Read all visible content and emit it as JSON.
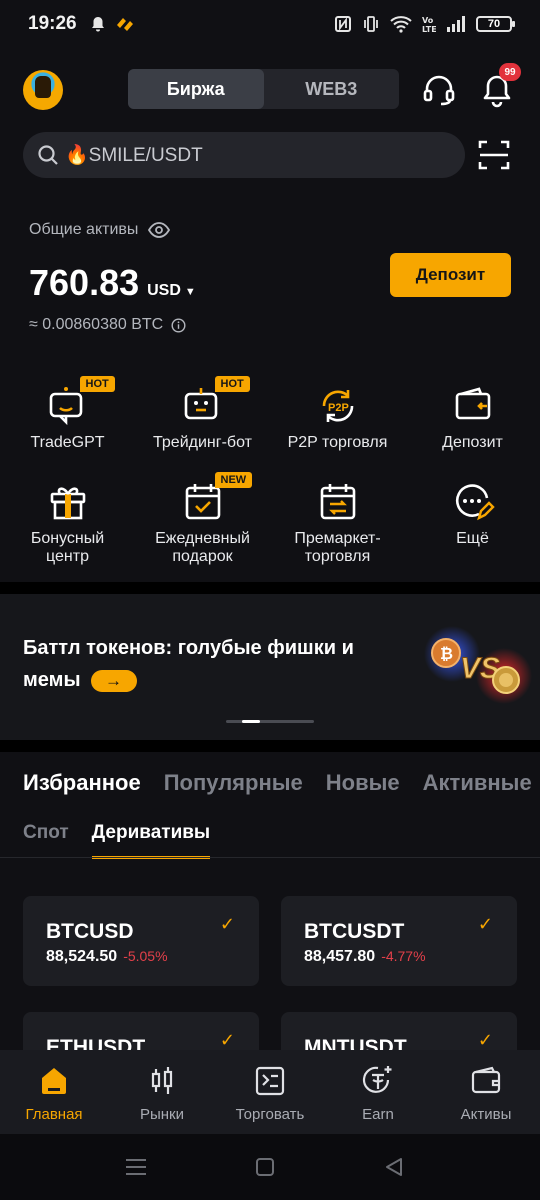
{
  "status_bar": {
    "time": "19:26",
    "battery": "70"
  },
  "header": {
    "segments": [
      "Биржа",
      "WEB3"
    ],
    "active_segment": 0,
    "notifications_badge": "99"
  },
  "search": {
    "value": "🔥SMILE/USDT"
  },
  "assets": {
    "label": "Общие активы",
    "amount": "760.83",
    "currency": "USD",
    "btc_equivalent": "≈ 0.00860380 BTC",
    "deposit_button": "Депозит"
  },
  "shortcuts": [
    {
      "label": "TradeGPT",
      "tag": "HOT",
      "icon": "tradegpt-icon"
    },
    {
      "label": "Трейдинг-бот",
      "tag": "HOT",
      "icon": "trading-bot-icon"
    },
    {
      "label": "P2P торговля",
      "tag": "",
      "icon": "p2p-icon"
    },
    {
      "label": "Депозит",
      "tag": "",
      "icon": "deposit-wallet-icon"
    },
    {
      "label": "Бонусный центр",
      "tag": "",
      "icon": "gift-icon"
    },
    {
      "label": "Ежедневный подарок",
      "tag": "NEW",
      "icon": "calendar-check-icon"
    },
    {
      "label": "Премаркет-торговля",
      "tag": "",
      "icon": "calendar-swap-icon"
    },
    {
      "label": "Ещё",
      "tag": "",
      "icon": "more-icon"
    }
  ],
  "banner": {
    "title": "Баттл токенов: голубые фишки и мемы",
    "art_text": "VS"
  },
  "market_tabs": [
    "Избранное",
    "Популярные",
    "Новые",
    "Активные"
  ],
  "market_sub_tabs": [
    "Спот",
    "Деривативы"
  ],
  "coins": [
    {
      "symbol": "BTCUSD",
      "price": "88,524.50",
      "change": "-5.05%"
    },
    {
      "symbol": "BTCUSDT",
      "price": "88,457.80",
      "change": "-4.77%"
    },
    {
      "symbol": "ETHUSDT",
      "price": "",
      "change": ""
    },
    {
      "symbol": "MNTUSDT",
      "price": "",
      "change": ""
    }
  ],
  "bottom_nav": [
    "Главная",
    "Рынки",
    "Торговать",
    "Earn",
    "Активы"
  ],
  "colors": {
    "accent": "#f7a600",
    "negative": "#e2404a",
    "background": "#101014"
  }
}
